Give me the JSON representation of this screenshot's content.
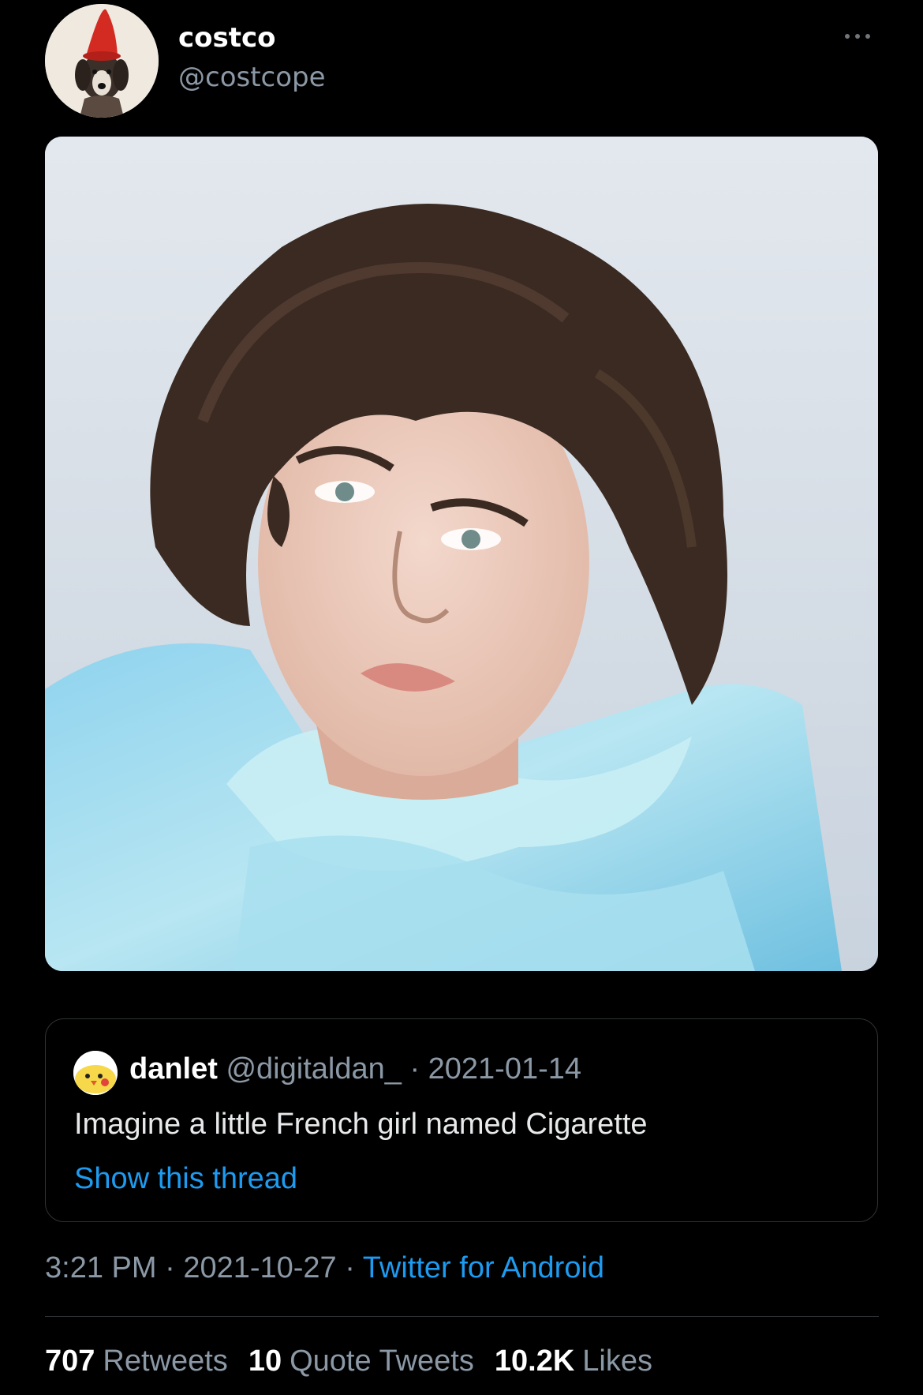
{
  "author": {
    "display_name": "costco",
    "handle": "@costcope",
    "avatar_icon": "dog-with-red-hat-avatar"
  },
  "more_icon": "more-options-icon",
  "quoted_tweet": {
    "display_name": "danlet",
    "handle": "@digitaldan_",
    "date": "· 2021-01-14",
    "avatar_icon": "chick-avatar",
    "text": "Imagine a little French girl named Cigarette",
    "show_thread": "Show this thread"
  },
  "meta": {
    "time": "3:21 PM",
    "separator1": " · ",
    "date": "2021-10-27",
    "separator2": " · ",
    "source": "Twitter for Android"
  },
  "stats": {
    "retweets_count": "707",
    "retweets_label": "Retweets",
    "quotes_count": "10",
    "quotes_label": "Quote Tweets",
    "likes_count": "10.2K",
    "likes_label": "Likes"
  },
  "colors": {
    "background": "#000000",
    "link": "#1d9bf0",
    "secondary_text": "#8b98a5",
    "border": "#2f3336"
  }
}
